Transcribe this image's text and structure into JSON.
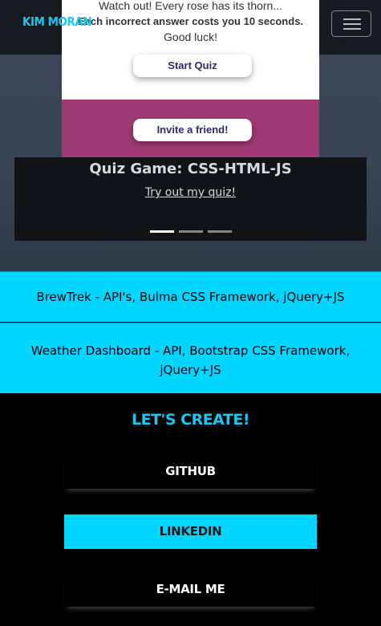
{
  "navbar": {
    "brand": "KIM MORAN",
    "toggler_icon": "hamburger-icon"
  },
  "carousel": {
    "slide_lines": [
      "Watch out! Every rose has its thorn...",
      "Each incorrect answer costs you 10 seconds.",
      "Good luck!"
    ],
    "start_button": "Start Quiz",
    "invite_button": "Invite a friend!",
    "caption_title": "Quiz Game: CSS-HTML-JS",
    "caption_link": "Try out my quiz!",
    "prev_icon": "chevron-left-icon",
    "next_icon": "chevron-right-icon",
    "indicators": 3,
    "active_indicator": 1
  },
  "projects": [
    "BrewTrek - API's, Bulma CSS Framework, jQuery+JS",
    "Weather Dashboard - API, Bootstrap CSS Framework, jQuery+JS"
  ],
  "create": {
    "title": "LET'S CREATE!",
    "github": "GITHUB",
    "linkedin": "LINKEDIN",
    "email": "E-MAIL ME"
  },
  "colors": {
    "accent": "#00d6ff",
    "brand": "#18c8f2",
    "background": "#000000"
  }
}
